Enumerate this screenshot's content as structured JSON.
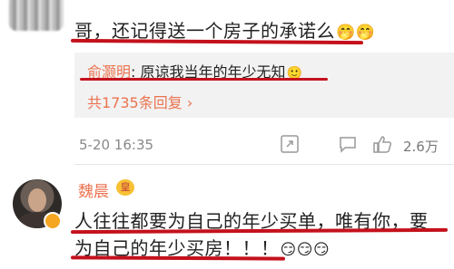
{
  "comment1": {
    "text": "哥，还记得送一个房子的承诺么",
    "emoji_name": "grin-emoji",
    "reply": {
      "user": "俞灏明",
      "sep": ": ",
      "text": "原谅我当年的年少无知",
      "emoji_name": "smile-emoji",
      "count_label": "共1735条回复 "
    },
    "time": "5-20 16:35",
    "like_count": "2.6万"
  },
  "comment2": {
    "user": "魏晨",
    "badge": "皇",
    "line1": "人往往都要为自己的年少买单，唯有你，要",
    "line2": "为自己的年少买房！！！",
    "emoji_name": "smirk-emoji"
  },
  "colors": {
    "accent": "#eb7350",
    "underline": "#c4111c",
    "reply_bg": "#f2f2f2",
    "badge": "#f5a623"
  }
}
